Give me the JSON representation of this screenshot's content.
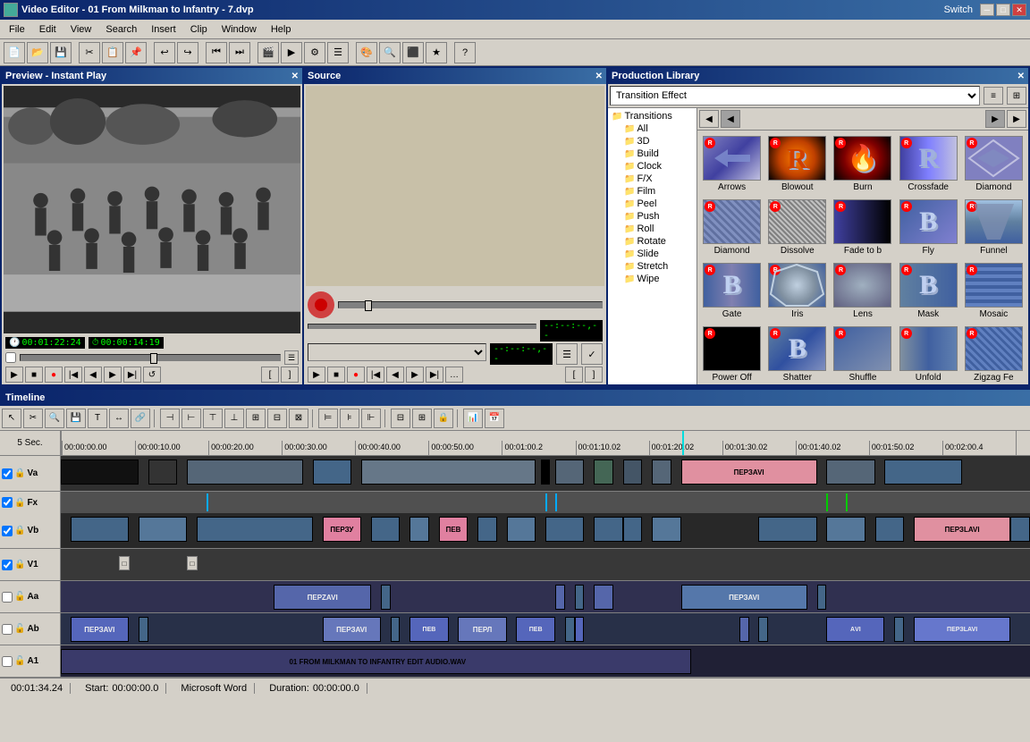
{
  "app": {
    "title": "Video Editor - 01 From Milkman to Infantry - 7.dvp",
    "icon": "video-editor-icon"
  },
  "titlebar": {
    "minimize": "─",
    "maximize": "□",
    "close": "✕",
    "switch_label": "Switch"
  },
  "menubar": {
    "items": [
      "File",
      "Edit",
      "View",
      "Search",
      "Insert",
      "Clip",
      "Window",
      "Help"
    ]
  },
  "preview": {
    "title": "Preview - Instant Play",
    "time_current": "00:01:22:24",
    "time_duration": "00:00:14:19",
    "transport": {
      "play": "▶",
      "stop": "■",
      "rewind": "◀◀",
      "fast_forward": "▶▶",
      "prev_frame": "◀",
      "next_frame": "▶",
      "prev_mark": "|◀",
      "next_mark": "▶|",
      "loop": "↺"
    }
  },
  "source": {
    "title": "Source"
  },
  "library": {
    "title": "Production Library",
    "filter_label": "Transition Effect",
    "view_options": [
      "list",
      "grid"
    ],
    "tree": {
      "root": "Transitions",
      "items": [
        "All",
        "3D",
        "Build",
        "Clock",
        "F/X",
        "Film",
        "Peel",
        "Push",
        "Roll",
        "Rotate",
        "Slide",
        "Stretch",
        "Wipe"
      ]
    },
    "items": [
      {
        "name": "Arrows",
        "thumb": "arrows"
      },
      {
        "name": "Blowout",
        "thumb": "blowout"
      },
      {
        "name": "Burn",
        "thumb": "burn"
      },
      {
        "name": "Crossfade",
        "thumb": "crossfade"
      },
      {
        "name": "Diamond",
        "thumb": "diamond"
      },
      {
        "name": "Diamond",
        "thumb": "diamond"
      },
      {
        "name": "Dissolve",
        "thumb": "dissolve"
      },
      {
        "name": "Fade to b",
        "thumb": "fadetob"
      },
      {
        "name": "Fly",
        "thumb": "fly"
      },
      {
        "name": "Funnel",
        "thumb": "funnel"
      },
      {
        "name": "Gate",
        "thumb": "gate"
      },
      {
        "name": "Iris",
        "thumb": "iris"
      },
      {
        "name": "Lens",
        "thumb": "lens"
      },
      {
        "name": "Mask",
        "thumb": "mask"
      },
      {
        "name": "Mosaic",
        "thumb": "mosaic"
      },
      {
        "name": "Power Off",
        "thumb": "poweroff"
      },
      {
        "name": "Shatter",
        "thumb": "shatter"
      },
      {
        "name": "Shuffle",
        "thumb": "shuffle"
      },
      {
        "name": "Unfold",
        "thumb": "unfold"
      },
      {
        "name": "Zigzag Fe",
        "thumb": "zigzag"
      }
    ]
  },
  "timeline": {
    "title": "Timeline",
    "timescale_label": "5 Sec.",
    "ruler_marks": [
      "00:00:00.00",
      "00:00:10.00",
      "00:00:20.00",
      "00:00:30.00",
      "00:00:40.00",
      "00:00:50.00",
      "00:01:00.2",
      "00:01:10.02",
      "00:01:20.02",
      "00:01:30.02",
      "00:01:40.02",
      "00:01:50.02",
      "00:02:00.4"
    ],
    "tracks": [
      {
        "name": "Va",
        "type": "video"
      },
      {
        "name": "Fx",
        "type": "fx"
      },
      {
        "name": "Vb",
        "type": "video"
      },
      {
        "name": "V1",
        "type": "video"
      },
      {
        "name": "Aa",
        "type": "audio"
      },
      {
        "name": "Ab",
        "type": "audio"
      },
      {
        "name": "A1",
        "type": "audio"
      }
    ]
  },
  "statusbar": {
    "time": "00:01:34.24",
    "start_label": "Start:",
    "start_value": "00:00:00.0",
    "app_label": "Microsoft Word",
    "duration_label": "Duration:",
    "duration_value": "00:00:00.0"
  }
}
